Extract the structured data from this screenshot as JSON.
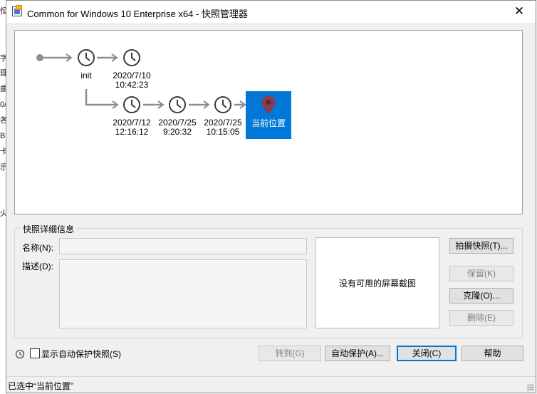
{
  "window": {
    "title": "Common for Windows 10 Enterprise x64 - 快照管理器",
    "close_glyph": "✕"
  },
  "background_window": {
    "side_glyphs": [
      "恒",
      "字",
      "理",
      "曲",
      "0/",
      "各",
      "B",
      "卡",
      "示",
      "火"
    ]
  },
  "snapshot_tree": {
    "nodes": [
      {
        "id": "init",
        "label": "init",
        "time": ""
      },
      {
        "id": "s1",
        "label": "2020/7/10",
        "time": "10:42:23"
      },
      {
        "id": "s2",
        "label": "2020/7/12",
        "time": "12:16:12"
      },
      {
        "id": "s3",
        "label": "2020/7/25",
        "time": "9:20:32"
      },
      {
        "id": "s4",
        "label": "2020/7/25",
        "time": "10:15:05"
      }
    ],
    "current": {
      "label": "当前位置",
      "icon": "location-pin-icon",
      "color": "#0078d7"
    }
  },
  "details": {
    "group_title": "快照详细信息",
    "name_label": "名称(N):",
    "name_value": "",
    "description_label": "描述(D):",
    "description_value": "",
    "no_screenshot_text": "没有可用的屏幕截图"
  },
  "buttons": {
    "take_snapshot": "拍摄快照(T)...",
    "keep": "保留(K)",
    "clone": "克隆(O)...",
    "delete": "删除(E)",
    "goto": "转到(G)",
    "autoprotect": "自动保护(A)...",
    "close": "关闭(C)",
    "help": "帮助"
  },
  "options": {
    "show_autoprotect_label": "显示自动保护快照(S)",
    "show_autoprotect_checked": false
  },
  "status": {
    "text": "已选中“当前位置”"
  },
  "colors": {
    "accent": "#0078d7",
    "connector": "#8a8f96",
    "pin": "#8b3c54"
  }
}
